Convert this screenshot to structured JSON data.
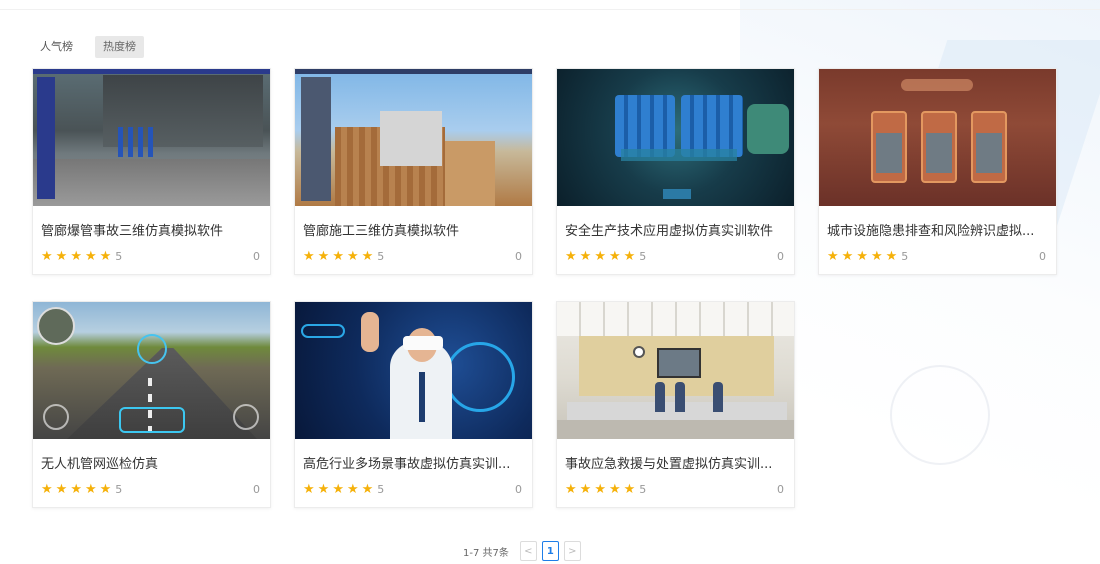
{
  "tabs": [
    {
      "label": "人气榜",
      "active": false
    },
    {
      "label": "热度榜",
      "active": true
    }
  ],
  "cards": [
    {
      "title": "管廊爆管事故三维仿真模拟软件",
      "rating": "5",
      "count": "0"
    },
    {
      "title": "管廊施工三维仿真模拟软件",
      "rating": "5",
      "count": "0"
    },
    {
      "title": "安全生产技术应用虚拟仿真实训软件",
      "rating": "5",
      "count": "0"
    },
    {
      "title": "城市设施隐患排查和风险辨识虚拟...",
      "rating": "5",
      "count": "0"
    },
    {
      "title": "无人机管网巡检仿真",
      "rating": "5",
      "count": "0"
    },
    {
      "title": "高危行业多场景事故虚拟仿真实训...",
      "rating": "5",
      "count": "0"
    },
    {
      "title": "事故应急救援与处置虚拟仿真实训...",
      "rating": "5",
      "count": "0"
    }
  ],
  "star_glyph": "★",
  "star_color": "#f5b10a",
  "pagination": {
    "total_text": "1-7 共7条",
    "prev": "<",
    "current": "1",
    "next": ">"
  },
  "colors": {
    "accent": "#1e7ee8",
    "active_tab_bg": "#e8e8e8"
  }
}
